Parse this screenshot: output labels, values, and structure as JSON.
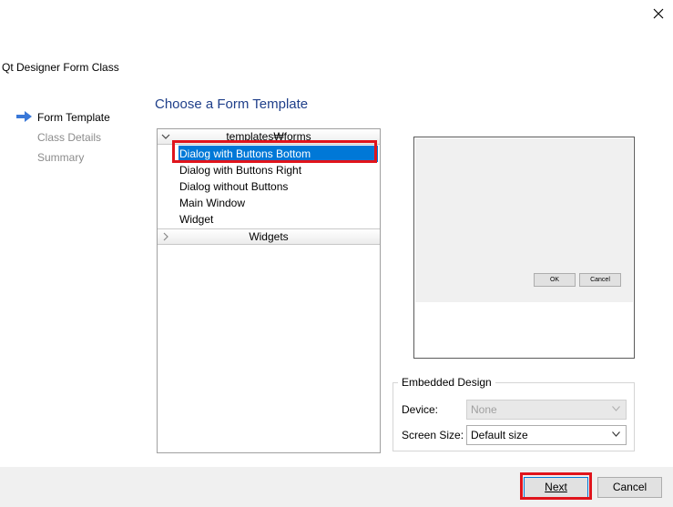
{
  "window": {
    "title": "Qt Designer Form Class",
    "close_icon": "close-icon"
  },
  "steps": [
    {
      "label": "Form Template",
      "active": true
    },
    {
      "label": "Class Details",
      "active": false
    },
    {
      "label": "Summary",
      "active": false
    }
  ],
  "page": {
    "title": "Choose a Form Template"
  },
  "tree": {
    "groups": [
      {
        "label": "templates₩forms",
        "expanded": true,
        "items": [
          {
            "label": "Dialog with Buttons Bottom",
            "selected": true
          },
          {
            "label": "Dialog with Buttons Right",
            "selected": false
          },
          {
            "label": "Dialog without Buttons",
            "selected": false
          },
          {
            "label": "Main Window",
            "selected": false
          },
          {
            "label": "Widget",
            "selected": false
          }
        ]
      },
      {
        "label": "Widgets",
        "expanded": false,
        "items": []
      }
    ]
  },
  "preview": {
    "ok_label": "OK",
    "cancel_label": "Cancel"
  },
  "embedded_design": {
    "title": "Embedded Design",
    "device_label": "Device:",
    "device_value": "None",
    "screen_size_label": "Screen Size:",
    "screen_size_value": "Default size"
  },
  "buttons": {
    "next_label": "Next",
    "cancel_label": "Cancel"
  },
  "colors": {
    "selection": "#0078d7",
    "highlight_box": "#e0141c",
    "page_title": "#1f3f8a"
  }
}
